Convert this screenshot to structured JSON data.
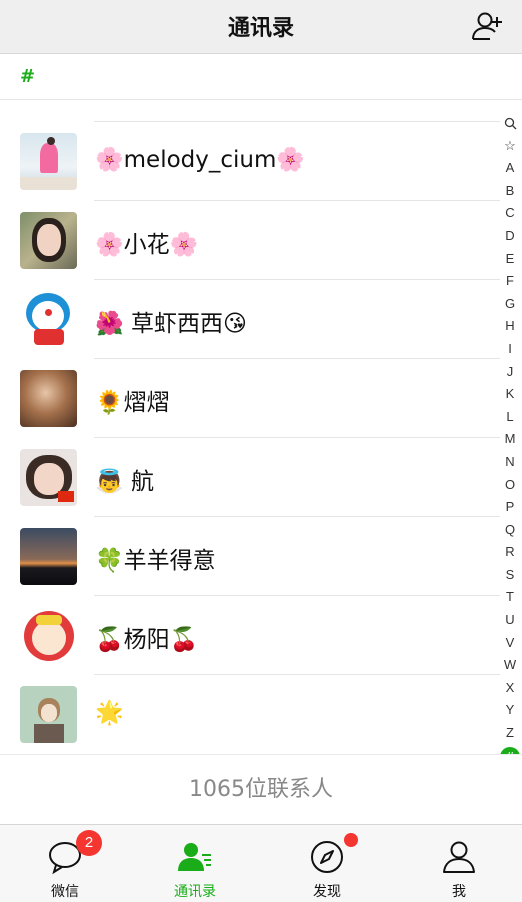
{
  "header": {
    "title": "通讯录"
  },
  "section": {
    "letter": "#"
  },
  "contacts": [
    {
      "name": "🌸melody_cium🌸"
    },
    {
      "name": "🌸小花🌸"
    },
    {
      "name": "🌺 草虾西西😘"
    },
    {
      "name": "🌻熠熠"
    },
    {
      "name": "👼 航"
    },
    {
      "name": "🍀羊羊得意"
    },
    {
      "name": "🍒杨阳🍒"
    },
    {
      "name": "🌟"
    }
  ],
  "index_bar": [
    "🔍",
    "☆",
    "A",
    "B",
    "C",
    "D",
    "E",
    "F",
    "G",
    "H",
    "I",
    "J",
    "K",
    "L",
    "M",
    "N",
    "O",
    "P",
    "Q",
    "R",
    "S",
    "T",
    "U",
    "V",
    "W",
    "X",
    "Y",
    "Z",
    "#"
  ],
  "footer": {
    "count_text": "1065位联系人"
  },
  "tabs": [
    {
      "label": "微信",
      "badge": "2"
    },
    {
      "label": "通讯录"
    },
    {
      "label": "发现"
    },
    {
      "label": "我"
    }
  ],
  "colors": {
    "accent": "#1aad19",
    "badge": "#f43530"
  }
}
